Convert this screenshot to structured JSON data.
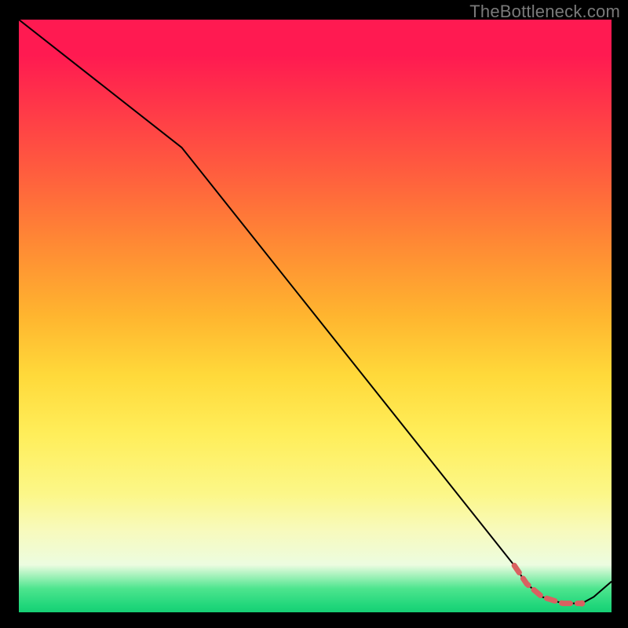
{
  "watermark": "TheBottleneck.com",
  "colors": {
    "line": "#000000",
    "dash": "#d96161",
    "dot": "#d96161",
    "background": "#000000"
  },
  "chart_data": {
    "type": "line",
    "title": "",
    "xlabel": "",
    "ylabel": "",
    "xlim": [
      0,
      100
    ],
    "ylim": [
      0,
      100
    ],
    "grid": false,
    "legend": false,
    "series": [
      {
        "name": "bottleneck-curve",
        "style": "solid",
        "color": "#000000",
        "points": [
          {
            "x": 0.0,
            "y": 100.0
          },
          {
            "x": 27.5,
            "y": 78.4
          },
          {
            "x": 83.6,
            "y": 7.9
          },
          {
            "x": 85.7,
            "y": 4.8
          },
          {
            "x": 88.3,
            "y": 2.6
          },
          {
            "x": 91.8,
            "y": 1.5
          },
          {
            "x": 95.0,
            "y": 1.5
          },
          {
            "x": 97.0,
            "y": 2.6
          },
          {
            "x": 100.0,
            "y": 5.2
          }
        ]
      },
      {
        "name": "optimal-segment",
        "style": "dashed",
        "color": "#d96161",
        "points": [
          {
            "x": 83.6,
            "y": 7.9
          },
          {
            "x": 85.7,
            "y": 4.8
          },
          {
            "x": 88.3,
            "y": 2.6
          },
          {
            "x": 91.8,
            "y": 1.5
          },
          {
            "x": 95.0,
            "y": 1.5
          }
        ]
      }
    ],
    "markers": [
      {
        "name": "end-marker",
        "x": 95.0,
        "y": 1.5,
        "color": "#d96161",
        "r": 4
      }
    ]
  }
}
